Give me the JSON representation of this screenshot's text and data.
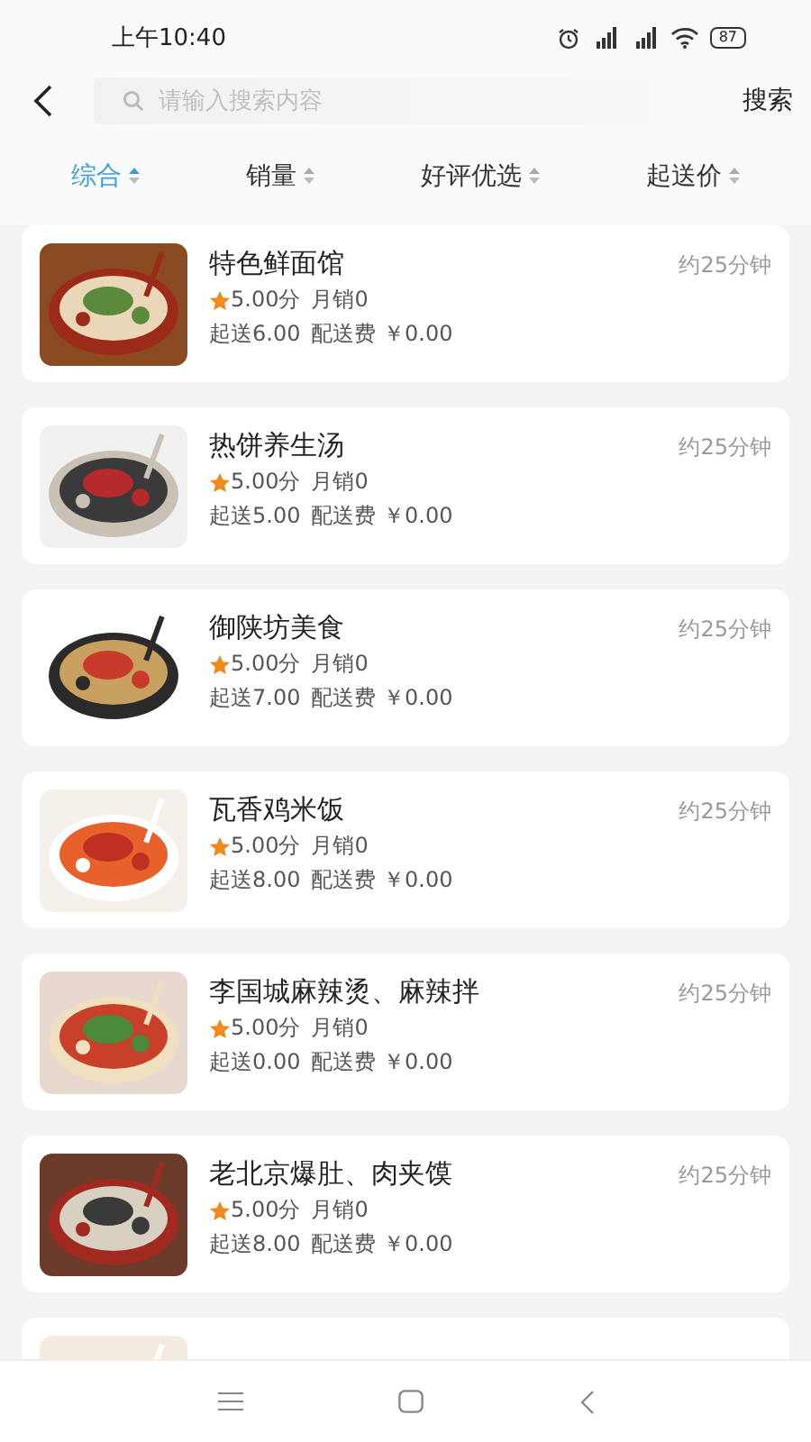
{
  "status_bar": {
    "time": "上午10:40",
    "battery": "87"
  },
  "search": {
    "placeholder": "请输入搜索内容",
    "button": "搜索"
  },
  "sort_tabs": [
    {
      "label": "综合",
      "selected": true
    },
    {
      "label": "销量",
      "selected": false
    },
    {
      "label": "好评优选",
      "selected": false
    },
    {
      "label": "起送价",
      "selected": false
    }
  ],
  "restaurants": [
    {
      "kind": "full",
      "name": "特色鲜面馆",
      "rating": "5.00分",
      "monthly_sales": "月销0",
      "min_order": "起送6.00",
      "delivery_fee": "配送费 ￥0.00",
      "eta": "约25分钟"
    },
    {
      "kind": "full",
      "name": "热饼养生汤",
      "rating": "5.00分",
      "monthly_sales": "月销0",
      "min_order": "起送5.00",
      "delivery_fee": "配送费 ￥0.00",
      "eta": "约25分钟"
    },
    {
      "kind": "full",
      "name": "御陕坊美食",
      "rating": "5.00分",
      "monthly_sales": "月销0",
      "min_order": "起送7.00",
      "delivery_fee": "配送费 ￥0.00",
      "eta": "约25分钟"
    },
    {
      "kind": "full",
      "name": "瓦香鸡米饭",
      "rating": "5.00分",
      "monthly_sales": "月销0",
      "min_order": "起送8.00",
      "delivery_fee": "配送费 ￥0.00",
      "eta": "约25分钟"
    },
    {
      "kind": "full",
      "name": "李国城麻辣烫、麻辣拌",
      "rating": "5.00分",
      "monthly_sales": "月销0",
      "min_order": "起送0.00",
      "delivery_fee": "配送费 ￥0.00",
      "eta": "约25分钟"
    },
    {
      "kind": "full",
      "name": "老北京爆肚、肉夹馍",
      "rating": "5.00分",
      "monthly_sales": "月销0",
      "min_order": "起送8.00",
      "delivery_fee": "配送费 ￥0.00",
      "eta": "约25分钟"
    },
    {
      "kind": "partial"
    }
  ]
}
